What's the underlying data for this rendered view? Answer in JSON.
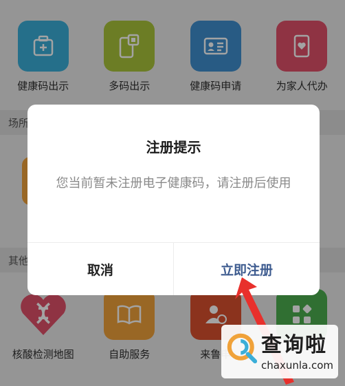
{
  "top_services": [
    {
      "label": "健康码出示",
      "icon": "medical-kit-icon",
      "color": "#3aaed8"
    },
    {
      "label": "多码出示",
      "icon": "phone-code-icon",
      "color": "#a9c43a"
    },
    {
      "label": "健康码申请",
      "icon": "id-card-icon",
      "color": "#3f8fcf"
    },
    {
      "label": "为家人代办",
      "icon": "phone-heart-icon",
      "color": "#e0506a"
    }
  ],
  "section1": {
    "title": "场所"
  },
  "section2": {
    "title": "其他"
  },
  "bottom_services": [
    {
      "label": "核酸检测地图",
      "icon": "dna-heart-icon",
      "color": "#e0506a"
    },
    {
      "label": "自助服务",
      "icon": "book-icon",
      "color": "#f0a23a"
    },
    {
      "label": "来鲁申",
      "icon": "user-globe-icon",
      "color": "#d9502e"
    },
    {
      "label": "",
      "icon": "grid-icon",
      "color": "#4cae4f"
    }
  ],
  "dialog": {
    "title": "注册提示",
    "message": "您当前暂未注册电子健康码，请注册后使用",
    "cancel_label": "取消",
    "confirm_label": "立即注册"
  },
  "watermark": {
    "text": "查询啦",
    "sub": "chaxunla.com"
  }
}
